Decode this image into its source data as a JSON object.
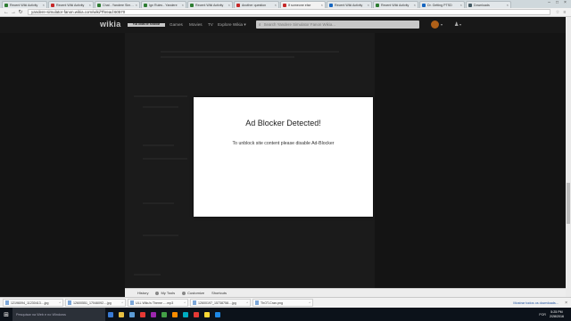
{
  "browser": {
    "tabs": [
      {
        "title": "Recent Wiki Activity",
        "color": "#2e7d32"
      },
      {
        "title": "Recent Wiki Activity",
        "color": "#c62828"
      },
      {
        "title": "Chat - Yandere Simulator",
        "color": "#2e7d32"
      },
      {
        "title": "Ign Rules - Yandere",
        "color": "#2e7d32"
      },
      {
        "title": "Recent Wiki Activity",
        "color": "#2e7d32"
      },
      {
        "title": "Another question",
        "color": "#c62828"
      },
      {
        "title": "If someone else",
        "color": "#c62828",
        "active": true
      },
      {
        "title": "Recent Wiki Activity",
        "color": "#1565c0"
      },
      {
        "title": "Recent Wiki Activity",
        "color": "#2e7d32"
      },
      {
        "title": "Dr. Getting PTSD",
        "color": "#1565c0"
      },
      {
        "title": "Downloads",
        "color": "#455a64"
      }
    ],
    "tab_close": "×",
    "window_controls": [
      "–",
      "□",
      "×"
    ],
    "back": "←",
    "forward": "→",
    "reload": "↻",
    "url": "yandere-simulator-fanon.wikia.com/wiki/Thread:60570",
    "star": "☆",
    "menu": "≡"
  },
  "wikia": {
    "logo": "wikia",
    "tagline": "THE HOME OF FANDOM",
    "nav": [
      "Games",
      "Movies",
      "TV",
      "Explore Wikia ▾"
    ],
    "search_icon": "⌕",
    "search_placeholder": "Search Yandere Simulator Fanon Wikia...",
    "avatar_chevron": "▾",
    "notification_icon": "♟",
    "notification_chevron": "▾"
  },
  "modal": {
    "title": "Ad Blocker Detected!",
    "message": "To unblock site content please disable Ad-Blocker"
  },
  "wikia_toolbar": {
    "items": [
      "History",
      "My Tools",
      "Customize",
      "Shortcuts"
    ]
  },
  "downloads": {
    "items": [
      "12196094_11230413....jpg",
      "12600551_17046092....jpg",
      "ULL Wiku's Theme -...mp3",
      "12600197_15738758....jpg",
      "ThOT-Cran.png"
    ],
    "show_all": "Mostrar todos os downloads...",
    "close": "×"
  },
  "taskbar": {
    "start": "⊞",
    "search_text": "Pesquisar na Web e no Windows",
    "apps": [
      "#3a7bd5",
      "#e8c042",
      "#5b9bd5",
      "#e53935",
      "#9c27b0",
      "#43a047",
      "#fb8c00",
      "#00acc1",
      "#e53935",
      "#fdd835",
      "#1e88e5"
    ],
    "lang": "POR",
    "time": "5:25 PM",
    "date": "2/28/2016"
  }
}
